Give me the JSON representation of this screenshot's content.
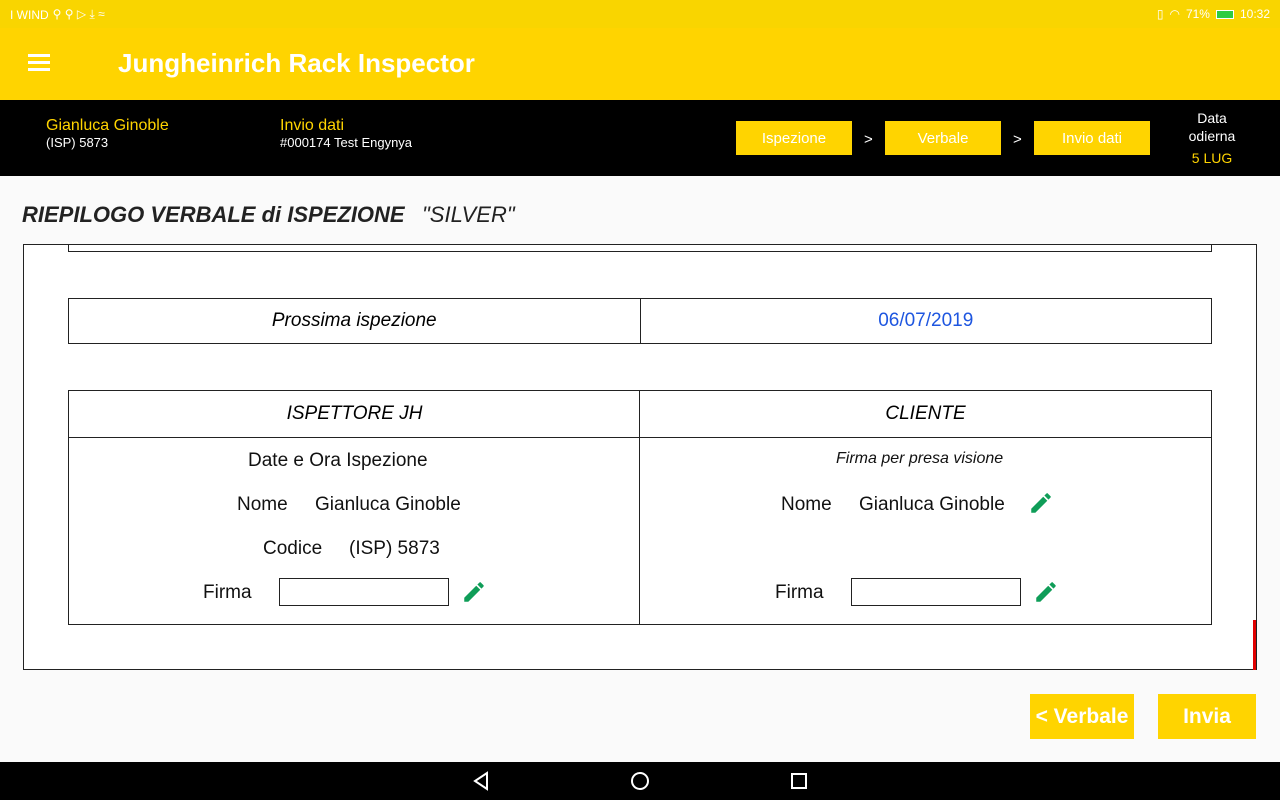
{
  "status": {
    "carrier": "I WIND",
    "battery": "71%",
    "time": "10:32"
  },
  "app": {
    "title": "Jungheinrich Rack Inspector"
  },
  "info": {
    "user_name": "Gianluca Ginoble",
    "user_code": "(ISP) 5873",
    "section": "Invio dati",
    "order": "#000174 Test Engynya",
    "steps": [
      "Ispezione",
      "Verbale",
      "Invio dati"
    ],
    "step_sep": ">",
    "date_label_1": "Data",
    "date_label_2": "odierna",
    "date_value": "5 LUG"
  },
  "page": {
    "title": "RIEPILOGO VERBALE di ISPEZIONE",
    "level": "\"SILVER\""
  },
  "next_inspection": {
    "label": "Prossima ispezione",
    "value": "06/07/2019"
  },
  "signatures": {
    "inspector_header": "ISPETTORE JH",
    "client_header": "CLIENTE",
    "date_time_label": "Date e Ora Ispezione",
    "client_note": "Firma per presa visione",
    "name_label": "Nome",
    "inspector_name": "Gianluca Ginoble",
    "code_label": "Codice",
    "inspector_code": "(ISP) 5873",
    "sign_label": "Firma",
    "client_name": "Gianluca Ginoble"
  },
  "buttons": {
    "back": "< Verbale",
    "send": "Invia"
  },
  "colors": {
    "accent": "#ffd400",
    "link": "#1e56e0",
    "edit": "#0f9d58",
    "scroll": "#e00000"
  }
}
